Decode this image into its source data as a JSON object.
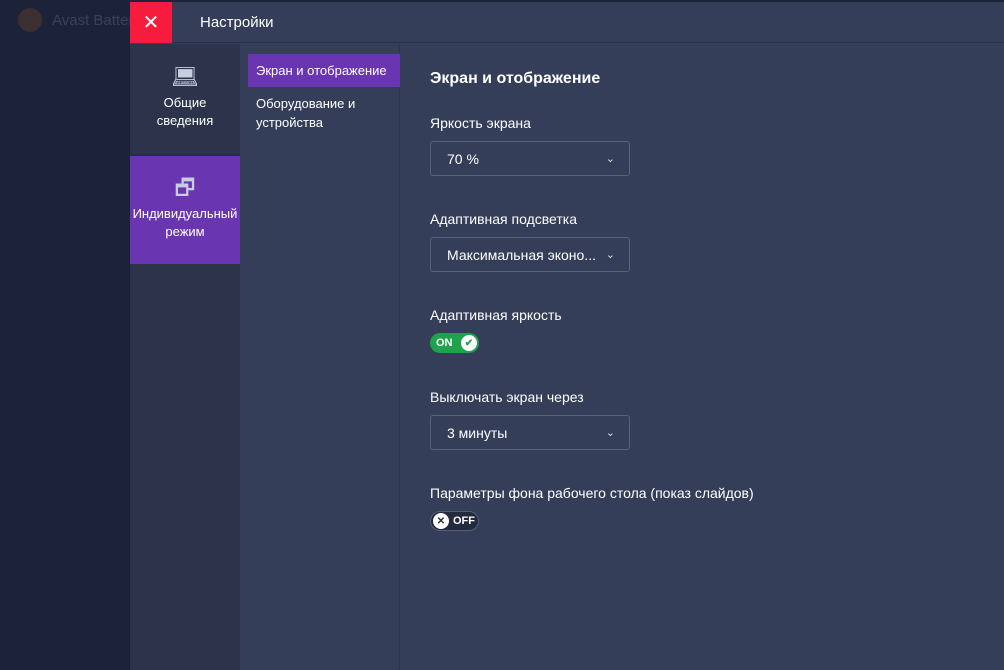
{
  "background_app": {
    "title": "Avast Batter"
  },
  "header": {
    "close": "✕",
    "title": "Настройки"
  },
  "sidebar": {
    "items": [
      {
        "label1": "Общие",
        "label2": "сведения"
      },
      {
        "label1": "Индивидуальный",
        "label2": "режим"
      }
    ]
  },
  "subnav": {
    "items": [
      "Экран и отображение",
      "Оборудование и устройства"
    ]
  },
  "content": {
    "heading": "Экран и отображение",
    "brightness": {
      "label": "Яркость экрана",
      "value": "70 %"
    },
    "adaptive_backlight": {
      "label": "Адаптивная подсветка",
      "value": "Максимальная эконо..."
    },
    "adaptive_brightness": {
      "label": "Адаптивная яркость",
      "state": "ON"
    },
    "screen_off": {
      "label": "Выключать экран через",
      "value": "3 минуты"
    },
    "wallpaper": {
      "label": "Параметры фона рабочего стола (показ слайдов)",
      "state": "OFF"
    }
  }
}
